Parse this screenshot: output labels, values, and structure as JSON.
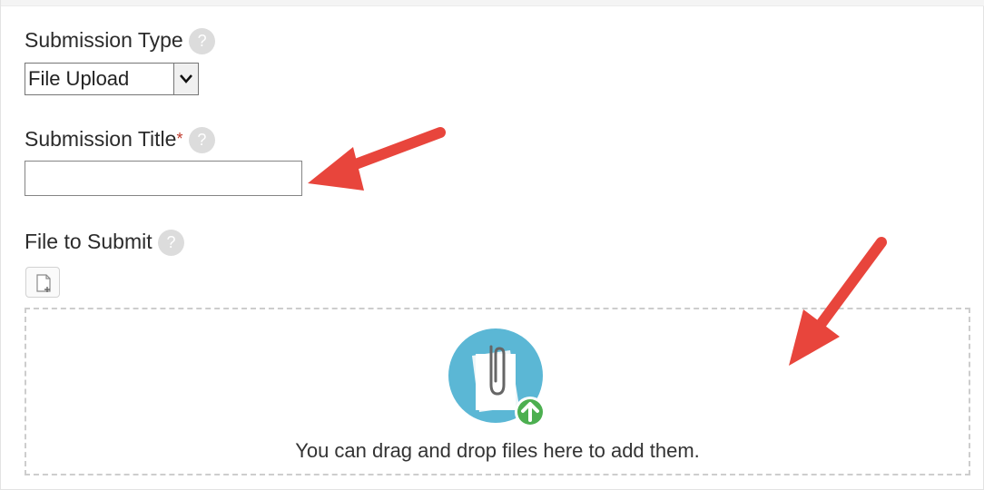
{
  "submission_type": {
    "label": "Submission Type",
    "help_icon": "question-mark-icon",
    "selected_value": "File Upload"
  },
  "submission_title": {
    "label": "Submission Title",
    "required_marker": "*",
    "help_icon": "question-mark-icon",
    "value": ""
  },
  "file_to_submit": {
    "label": "File to Submit",
    "help_icon": "question-mark-icon",
    "add_file_icon": "add-file-icon",
    "dropzone_icon": "paperclip-upload-icon",
    "dropzone_text": "You can drag and drop files here to add them."
  },
  "colors": {
    "annotation_arrow": "#e8453c",
    "dropzone_icon_circle": "#5bb7d5",
    "upload_badge": "#4caf50",
    "help_icon_bg": "#dcdcdc"
  }
}
